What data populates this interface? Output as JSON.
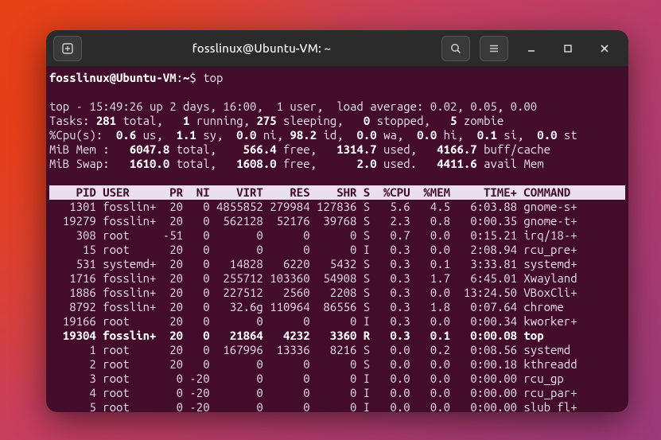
{
  "titlebar": {
    "title": "fosslinux@Ubuntu-VM: ~"
  },
  "prompt": {
    "userhost": "fosslinux@Ubuntu-VM",
    "path": "~",
    "command": "top"
  },
  "summary": {
    "line1": "top - 15:49:26 up 2 days, 16:00,  1 user,  load average: 0.02, 0.05, 0.00",
    "tasks": {
      "label": "Tasks:",
      "total": "281",
      "running": "1",
      "sleeping": "275",
      "stopped": "0",
      "zombie": "5"
    },
    "cpu": {
      "label": "%Cpu(s):",
      "us": "0.6",
      "sy": "1.1",
      "ni": "0.0",
      "id": "98.2",
      "wa": "0.0",
      "hi": "0.0",
      "si": "0.1",
      "st": "0.0"
    },
    "mem": {
      "label": "MiB Mem :",
      "total": "6047.8",
      "free": "566.4",
      "used": "1314.7",
      "buff": "4166.7"
    },
    "swap": {
      "label": "MiB Swap:",
      "total": "1610.0",
      "free": "1608.0",
      "used": "2.0",
      "avail": "4411.6"
    }
  },
  "columns": [
    "PID",
    "USER",
    "PR",
    "NI",
    "VIRT",
    "RES",
    "SHR",
    "S",
    "%CPU",
    "%MEM",
    "TIME+",
    "COMMAND"
  ],
  "rows": [
    {
      "pid": "1301",
      "user": "fosslin+",
      "pr": "20",
      "ni": "0",
      "virt": "4855852",
      "res": "279984",
      "shr": "127836",
      "s": "S",
      "cpu": "5.6",
      "mem": "4.5",
      "time": "6:03.88",
      "cmd": "gnome-s+",
      "bold": false
    },
    {
      "pid": "19279",
      "user": "fosslin+",
      "pr": "20",
      "ni": "0",
      "virt": "562128",
      "res": "52176",
      "shr": "39768",
      "s": "S",
      "cpu": "2.3",
      "mem": "0.8",
      "time": "0:00.35",
      "cmd": "gnome-t+",
      "bold": false
    },
    {
      "pid": "308",
      "user": "root",
      "pr": "-51",
      "ni": "0",
      "virt": "0",
      "res": "0",
      "shr": "0",
      "s": "S",
      "cpu": "0.7",
      "mem": "0.0",
      "time": "0:15.21",
      "cmd": "irq/18-+",
      "bold": false
    },
    {
      "pid": "15",
      "user": "root",
      "pr": "20",
      "ni": "0",
      "virt": "0",
      "res": "0",
      "shr": "0",
      "s": "I",
      "cpu": "0.3",
      "mem": "0.0",
      "time": "2:08.94",
      "cmd": "rcu_pre+",
      "bold": false
    },
    {
      "pid": "531",
      "user": "systemd+",
      "pr": "20",
      "ni": "0",
      "virt": "14828",
      "res": "6220",
      "shr": "5432",
      "s": "S",
      "cpu": "0.3",
      "mem": "0.1",
      "time": "3:33.81",
      "cmd": "systemd+",
      "bold": false
    },
    {
      "pid": "1716",
      "user": "fosslin+",
      "pr": "20",
      "ni": "0",
      "virt": "255712",
      "res": "103360",
      "shr": "54908",
      "s": "S",
      "cpu": "0.3",
      "mem": "1.7",
      "time": "6:45.01",
      "cmd": "Xwayland",
      "bold": false
    },
    {
      "pid": "1886",
      "user": "fosslin+",
      "pr": "20",
      "ni": "0",
      "virt": "227512",
      "res": "2560",
      "shr": "2208",
      "s": "S",
      "cpu": "0.3",
      "mem": "0.0",
      "time": "13:24.50",
      "cmd": "VBoxCli+",
      "bold": false
    },
    {
      "pid": "8792",
      "user": "fosslin+",
      "pr": "20",
      "ni": "0",
      "virt": "32.6g",
      "res": "110964",
      "shr": "86556",
      "s": "S",
      "cpu": "0.3",
      "mem": "1.8",
      "time": "0:07.64",
      "cmd": "chrome",
      "bold": false
    },
    {
      "pid": "19166",
      "user": "root",
      "pr": "20",
      "ni": "0",
      "virt": "0",
      "res": "0",
      "shr": "0",
      "s": "I",
      "cpu": "0.3",
      "mem": "0.0",
      "time": "0:00.34",
      "cmd": "kworker+",
      "bold": false
    },
    {
      "pid": "19304",
      "user": "fosslin+",
      "pr": "20",
      "ni": "0",
      "virt": "21864",
      "res": "4232",
      "shr": "3360",
      "s": "R",
      "cpu": "0.3",
      "mem": "0.1",
      "time": "0:00.08",
      "cmd": "top",
      "bold": true
    },
    {
      "pid": "1",
      "user": "root",
      "pr": "20",
      "ni": "0",
      "virt": "167996",
      "res": "13336",
      "shr": "8216",
      "s": "S",
      "cpu": "0.0",
      "mem": "0.2",
      "time": "0:08.56",
      "cmd": "systemd",
      "bold": false
    },
    {
      "pid": "2",
      "user": "root",
      "pr": "20",
      "ni": "0",
      "virt": "0",
      "res": "0",
      "shr": "0",
      "s": "S",
      "cpu": "0.0",
      "mem": "0.0",
      "time": "0:00.18",
      "cmd": "kthreadd",
      "bold": false
    },
    {
      "pid": "3",
      "user": "root",
      "pr": "0",
      "ni": "-20",
      "virt": "0",
      "res": "0",
      "shr": "0",
      "s": "I",
      "cpu": "0.0",
      "mem": "0.0",
      "time": "0:00.00",
      "cmd": "rcu_gp",
      "bold": false
    },
    {
      "pid": "4",
      "user": "root",
      "pr": "0",
      "ni": "-20",
      "virt": "0",
      "res": "0",
      "shr": "0",
      "s": "I",
      "cpu": "0.0",
      "mem": "0.0",
      "time": "0:00.00",
      "cmd": "rcu_par+",
      "bold": false
    },
    {
      "pid": "5",
      "user": "root",
      "pr": "0",
      "ni": "-20",
      "virt": "0",
      "res": "0",
      "shr": "0",
      "s": "I",
      "cpu": "0.0",
      "mem": "0.0",
      "time": "0:00.00",
      "cmd": "slub_fl+",
      "bold": false
    }
  ]
}
